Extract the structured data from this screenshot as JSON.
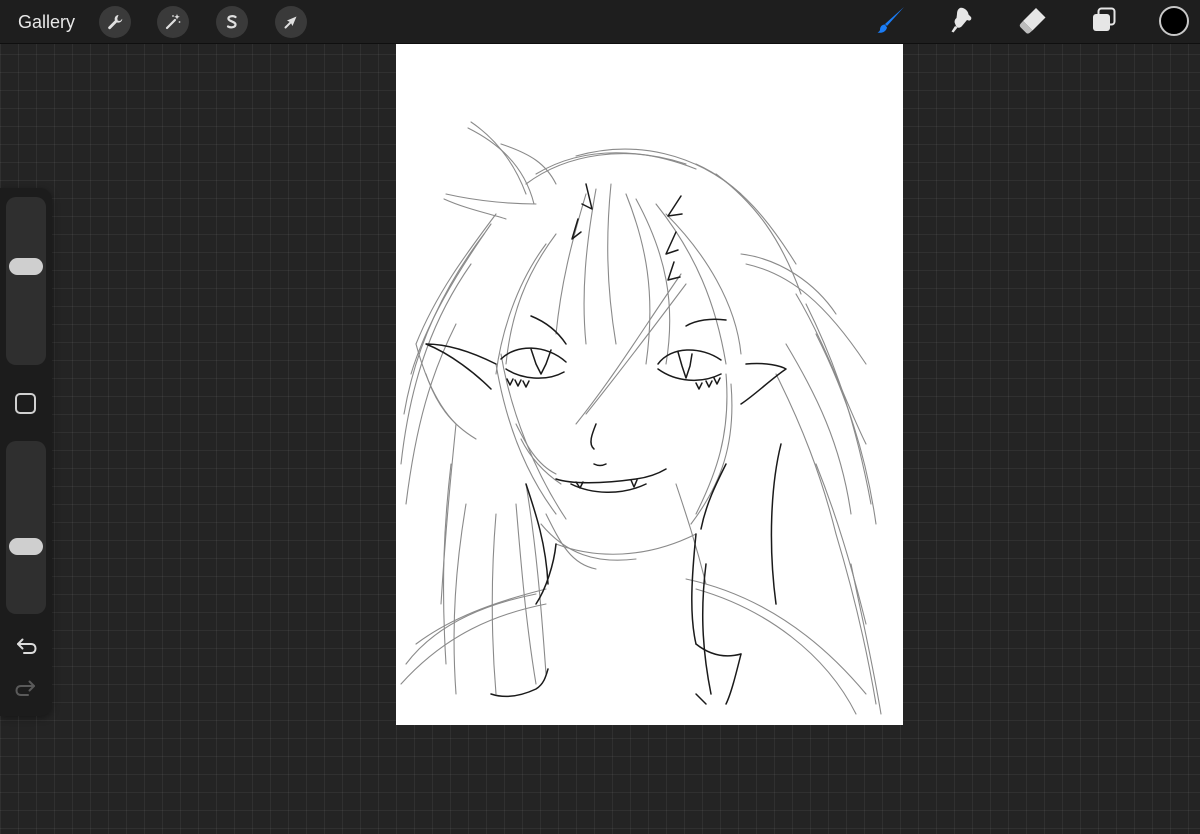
{
  "topbar": {
    "gallery_label": "Gallery",
    "left_tools": [
      {
        "name": "actions",
        "icon": "wrench-icon"
      },
      {
        "name": "adjustments",
        "icon": "magic-wand-icon"
      },
      {
        "name": "selection",
        "icon": "selection-s-icon"
      },
      {
        "name": "transform",
        "icon": "arrow-cursor-icon"
      }
    ],
    "right_tools": [
      {
        "name": "brush",
        "icon": "brush-icon",
        "active": true
      },
      {
        "name": "smudge",
        "icon": "smudge-icon",
        "active": false
      },
      {
        "name": "eraser",
        "icon": "eraser-icon",
        "active": false
      },
      {
        "name": "layers",
        "icon": "layers-icon",
        "active": false
      }
    ],
    "current_color": "#000000",
    "accent_color": "#1a7cf5"
  },
  "sidebar": {
    "brush_size_level": 0.6,
    "opacity_level": 0.37,
    "modify_icon": "square-icon",
    "undo_icon": "undo-icon",
    "redo_icon": "redo-icon"
  },
  "canvas": {
    "background": "#ffffff",
    "content": "pencil-sketch"
  }
}
